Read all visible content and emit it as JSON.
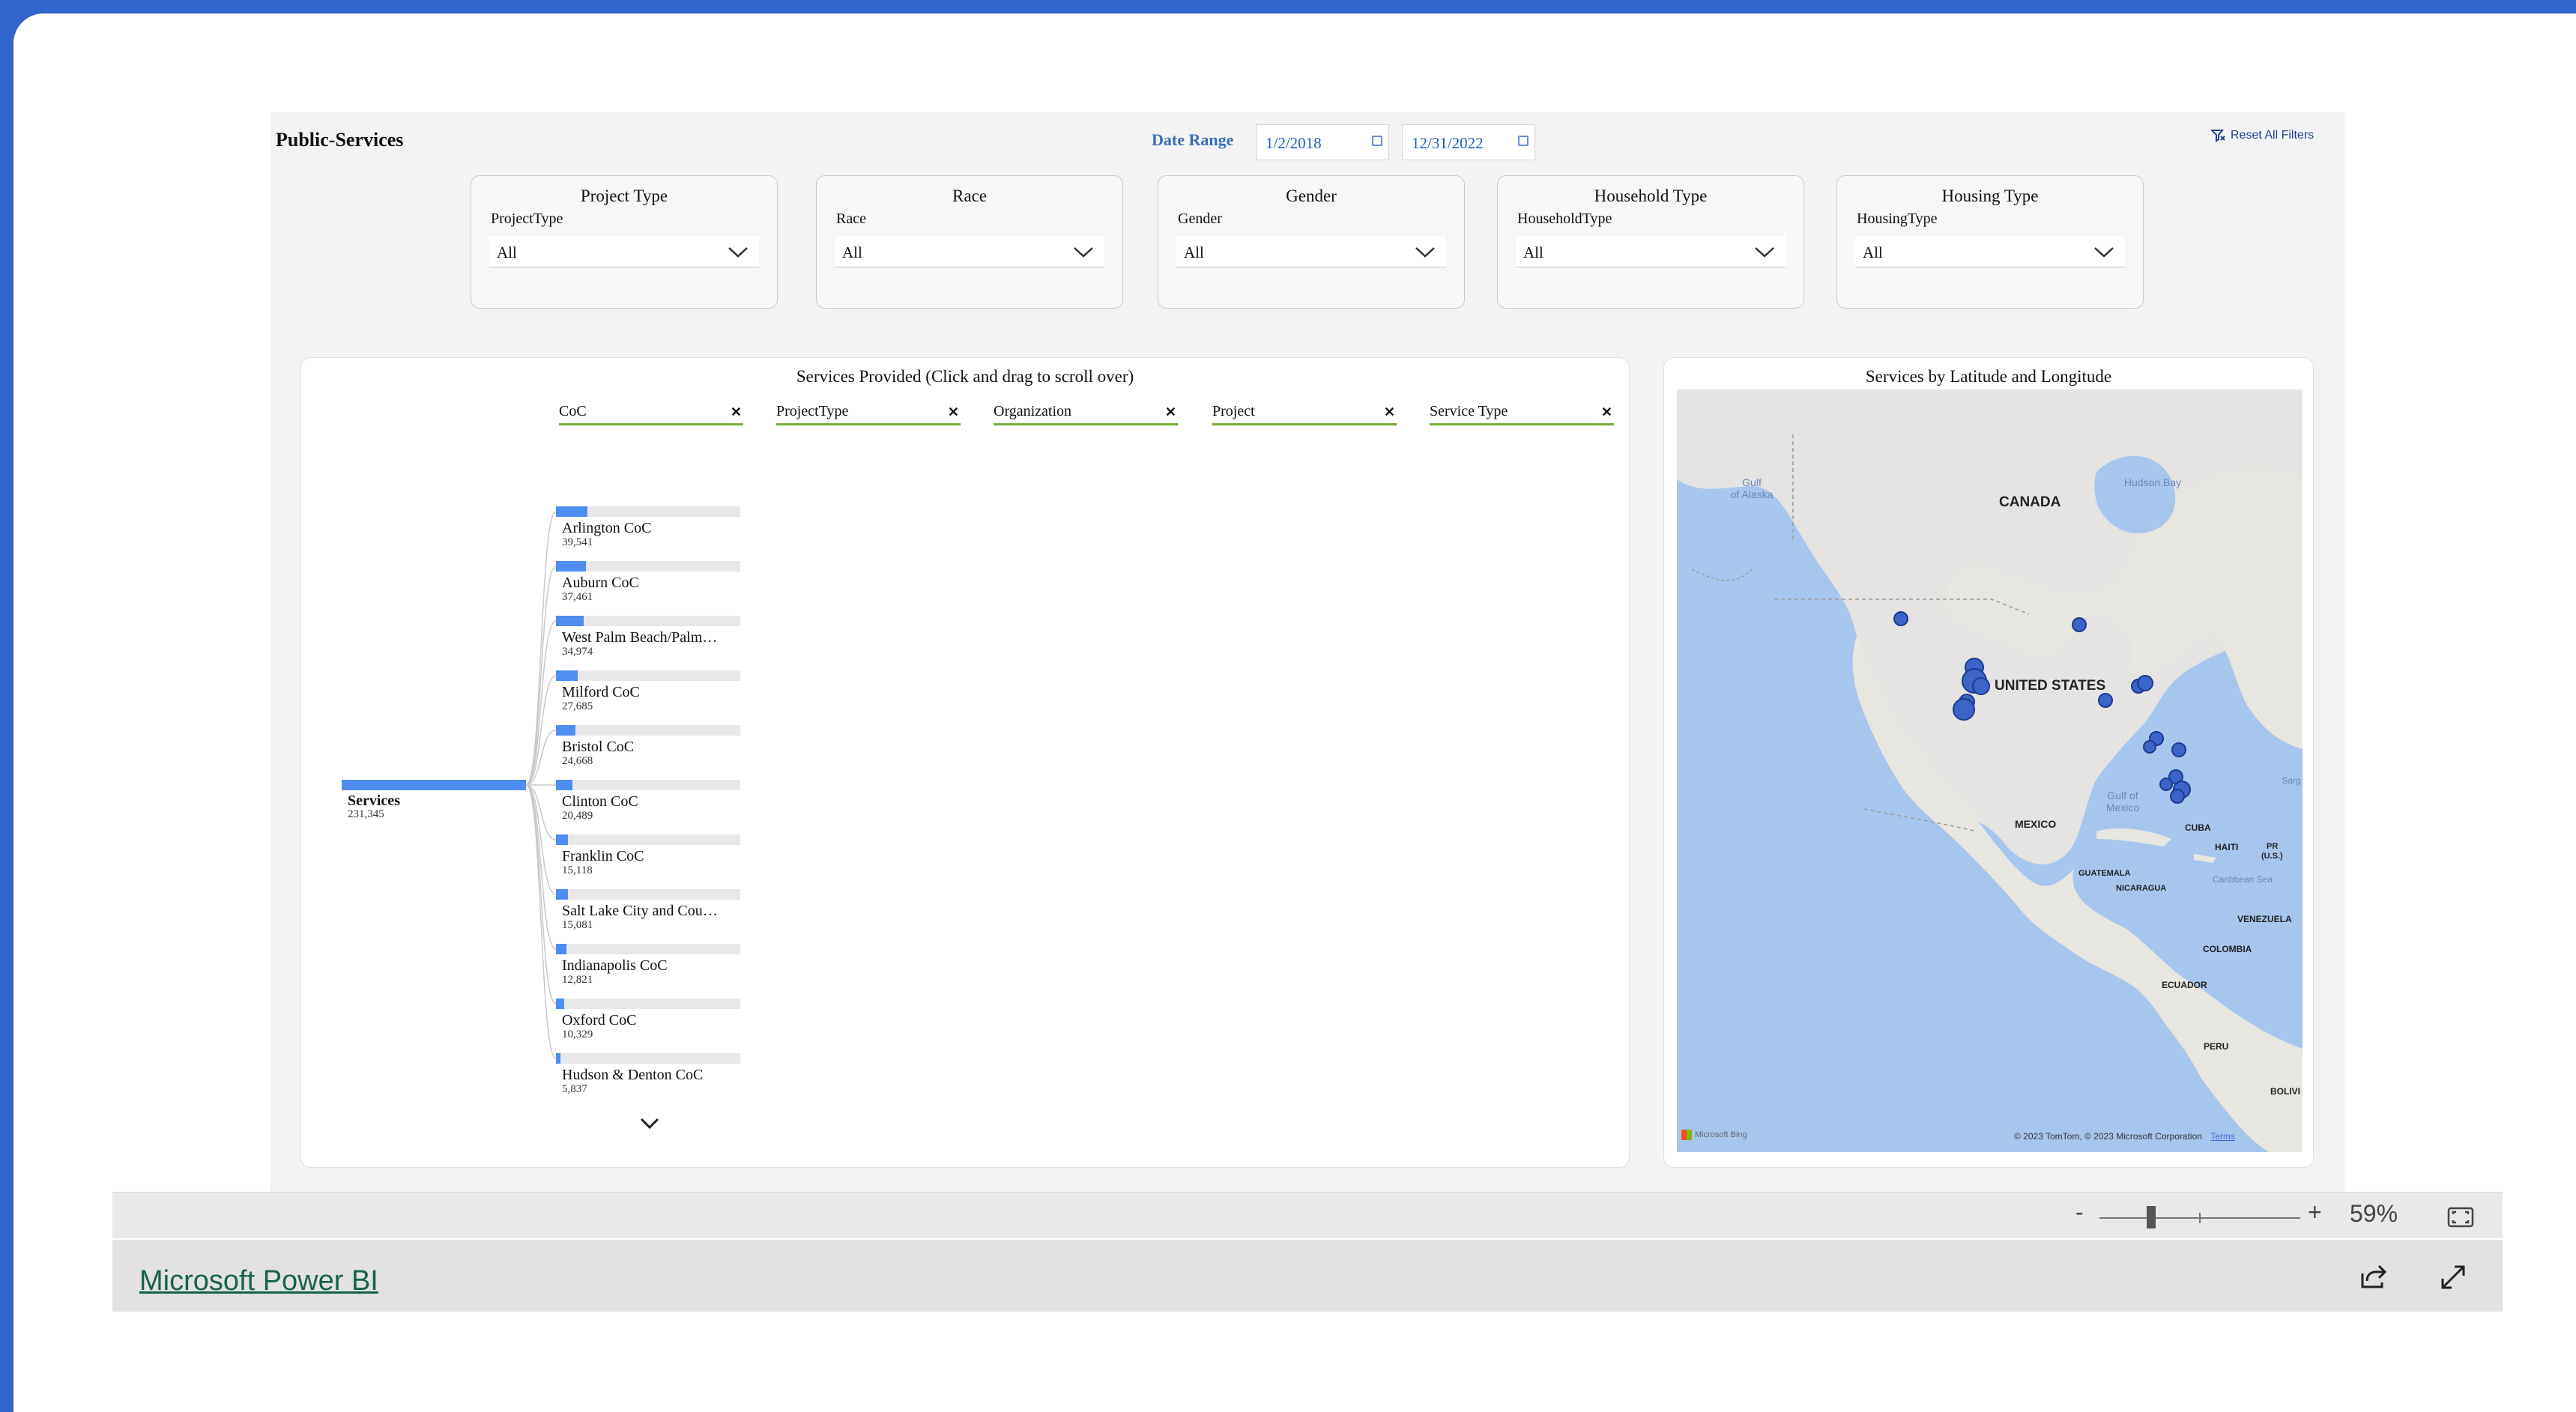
{
  "report": {
    "title": "Public-Services",
    "date_range": {
      "label": "Date Range",
      "start": "1/2/2018",
      "end": "12/31/2022"
    },
    "reset_label": "Reset All Filters"
  },
  "slicers": [
    {
      "header": "Project Type",
      "field": "ProjectType",
      "value": "All"
    },
    {
      "header": "Race",
      "field": "Race",
      "value": "All"
    },
    {
      "header": "Gender",
      "field": "Gender",
      "value": "All"
    },
    {
      "header": "Household Type",
      "field": "HouseholdType",
      "value": "All"
    },
    {
      "header": "Housing Type",
      "field": "HousingType",
      "value": "All"
    }
  ],
  "tree": {
    "title": "Services Provided (Click and drag to scroll over)",
    "levels": [
      "CoC",
      "ProjectType",
      "Organization",
      "Project",
      "Service Type"
    ],
    "root": {
      "name": "Services",
      "value": "231,345",
      "count": 231345
    },
    "nodes": [
      {
        "name": "Arlington CoC",
        "value": "39,541",
        "count": 39541
      },
      {
        "name": "Auburn CoC",
        "value": "37,461",
        "count": 37461
      },
      {
        "name": "West Palm Beach/Palm…",
        "value": "34,974",
        "count": 34974
      },
      {
        "name": "Milford CoC",
        "value": "27,685",
        "count": 27685
      },
      {
        "name": "Bristol CoC",
        "value": "24,668",
        "count": 24668
      },
      {
        "name": "Clinton CoC",
        "value": "20,489",
        "count": 20489
      },
      {
        "name": "Franklin CoC",
        "value": "15,118",
        "count": 15118
      },
      {
        "name": "Salt Lake City and Cou…",
        "value": "15,081",
        "count": 15081
      },
      {
        "name": "Indianapolis CoC",
        "value": "12,821",
        "count": 12821
      },
      {
        "name": "Oxford CoC",
        "value": "10,329",
        "count": 10329
      },
      {
        "name": "Hudson & Denton CoC",
        "value": "5,837",
        "count": 5837
      }
    ]
  },
  "map": {
    "title": "Services by Latitude and Longitude",
    "labels": {
      "canada": "CANADA",
      "us": "UNITED STATES",
      "mexico": "MEXICO",
      "cuba": "CUBA",
      "haiti": "HAITI",
      "pr": "PR",
      "pr_sub": "(U.S.)",
      "guatemala": "GUATEMALA",
      "nicaragua": "NICARAGUA",
      "venezuela": "VENEZUELA",
      "colombia": "COLOMBIA",
      "ecuador": "ECUADOR",
      "peru": "PERU",
      "bolivia": "BOLIVI",
      "gulf_alaska": "Gulf\nof Alaska",
      "hudson_bay": "Hudson Bay",
      "gulf_mexico": "Gulf of\nMexico",
      "caribbean": "Caribbean Sea",
      "sargasso": "Sarg"
    },
    "attribution": "© 2023 TomTom, © 2023 Microsoft Corporation",
    "terms": "Terms",
    "bing": "Microsoft Bing"
  },
  "viewer": {
    "zoom_minus": "-",
    "zoom_plus": "+",
    "zoom_value": "59%",
    "zoom_level": 0.59,
    "brand_link": "Microsoft Power BI"
  },
  "colors": {
    "accent": "#4f8df0",
    "frame": "#3366cc",
    "level_underline": "#74ad3a",
    "brand": "#17624a"
  }
}
